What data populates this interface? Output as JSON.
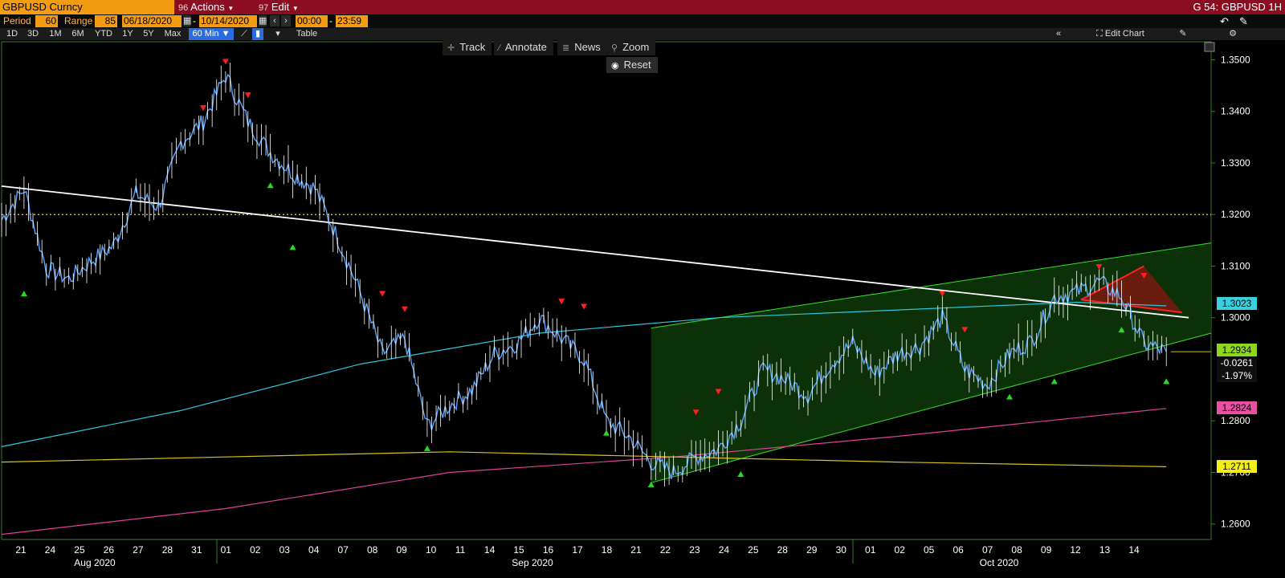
{
  "toolbar": {
    "ticker": "GBPUSD Curncy",
    "actions_num": "96",
    "actions": "Actions",
    "edit_num": "97",
    "edit": "Edit",
    "right_title": "G 54: GBPUSD 1H"
  },
  "params": {
    "period_label": "Period",
    "period_value": "60",
    "range_label": "Range",
    "range_value": "85",
    "start_date": "06/18/2020",
    "end_date": "10/14/2020",
    "start_time": "00:00",
    "end_time": "23:59"
  },
  "ranges": [
    "1D",
    "3D",
    "1M",
    "6M",
    "YTD",
    "1Y",
    "5Y",
    "Max"
  ],
  "range_selected": "60 Min",
  "table_label": "Table",
  "edit_chart": "Edit Chart",
  "chart_tools": {
    "track": "Track",
    "annotate": "Annotate",
    "news": "News",
    "zoom": "Zoom",
    "reset": "Reset"
  },
  "chart_data": {
    "type": "line",
    "ylim": [
      1.257,
      1.3535
    ],
    "y_ticks": [
      "1.3500",
      "1.3400",
      "1.3300",
      "1.3200",
      "1.3100",
      "1.3000",
      "1.2800",
      "1.2700",
      "1.2600"
    ],
    "x_day_labels": [
      "21",
      "24",
      "25",
      "26",
      "27",
      "28",
      "31",
      "01",
      "02",
      "03",
      "04",
      "07",
      "08",
      "09",
      "10",
      "11",
      "14",
      "15",
      "16",
      "17",
      "18",
      "21",
      "22",
      "23",
      "24",
      "25",
      "28",
      "29",
      "30",
      "01",
      "02",
      "05",
      "06",
      "07",
      "08",
      "09",
      "12",
      "13",
      "14"
    ],
    "month_labels": [
      "Aug 2020",
      "Sep 2020",
      "Oct 2020"
    ],
    "price_series": [
      [
        0,
        1.319
      ],
      [
        1,
        1.325
      ],
      [
        2,
        1.3095
      ],
      [
        3,
        1.3075
      ],
      [
        4,
        1.311
      ],
      [
        5,
        1.314
      ],
      [
        6,
        1.324
      ],
      [
        7,
        1.3215
      ],
      [
        8,
        1.334
      ],
      [
        9,
        1.338
      ],
      [
        10,
        1.347
      ],
      [
        11,
        1.338
      ],
      [
        12,
        1.332
      ],
      [
        13,
        1.328
      ],
      [
        14,
        1.325
      ],
      [
        15,
        1.3155
      ],
      [
        16,
        1.305
      ],
      [
        17,
        1.293
      ],
      [
        18,
        1.296
      ],
      [
        19,
        1.279
      ],
      [
        20,
        1.283
      ],
      [
        21,
        1.286
      ],
      [
        22,
        1.293
      ],
      [
        23,
        1.295
      ],
      [
        24,
        1.3
      ],
      [
        25,
        1.296
      ],
      [
        26,
        1.292
      ],
      [
        27,
        1.28
      ],
      [
        28,
        1.277
      ],
      [
        29,
        1.272
      ],
      [
        30,
        1.27
      ],
      [
        31,
        1.273
      ],
      [
        32,
        1.2745
      ],
      [
        33,
        1.28
      ],
      [
        34,
        1.29
      ],
      [
        35,
        1.288
      ],
      [
        36,
        1.285
      ],
      [
        37,
        1.291
      ],
      [
        38,
        1.295
      ],
      [
        39,
        1.289
      ],
      [
        40,
        1.293
      ],
      [
        41,
        1.2945
      ],
      [
        42,
        1.3
      ],
      [
        43,
        1.29
      ],
      [
        44,
        1.287
      ],
      [
        45,
        1.293
      ],
      [
        46,
        1.2955
      ],
      [
        47,
        1.304
      ],
      [
        48,
        1.305
      ],
      [
        49,
        1.307
      ],
      [
        50,
        1.304
      ],
      [
        51,
        1.295
      ],
      [
        52,
        1.2934
      ]
    ],
    "cyan_ma": [
      [
        0,
        1.275
      ],
      [
        8,
        1.282
      ],
      [
        16,
        1.291
      ],
      [
        24,
        1.297
      ],
      [
        32,
        1.3
      ],
      [
        40,
        1.3015
      ],
      [
        48,
        1.303
      ],
      [
        52,
        1.3023
      ]
    ],
    "magenta_ma": [
      [
        0,
        1.258
      ],
      [
        10,
        1.263
      ],
      [
        20,
        1.27
      ],
      [
        30,
        1.273
      ],
      [
        40,
        1.277
      ],
      [
        52,
        1.2824
      ]
    ],
    "yellow_ma": [
      [
        0,
        1.272
      ],
      [
        20,
        1.274
      ],
      [
        30,
        1.273
      ],
      [
        40,
        1.272
      ],
      [
        52,
        1.2711
      ]
    ],
    "trendline": [
      [
        0,
        1.3255
      ],
      [
        53,
        1.3
      ]
    ],
    "resistance": 1.32,
    "channel_upper": [
      [
        29,
        1.298
      ],
      [
        54,
        1.3145
      ]
    ],
    "channel_lower": [
      [
        29,
        1.268
      ],
      [
        54,
        1.297
      ]
    ],
    "last_price_line": 1.2934,
    "price_tags": {
      "cyan": "1.3023",
      "last": "1.2934",
      "change": "-0.0261",
      "change_pct": "-1.97%",
      "magenta": "1.2824",
      "yellow": "1.2711"
    }
  }
}
